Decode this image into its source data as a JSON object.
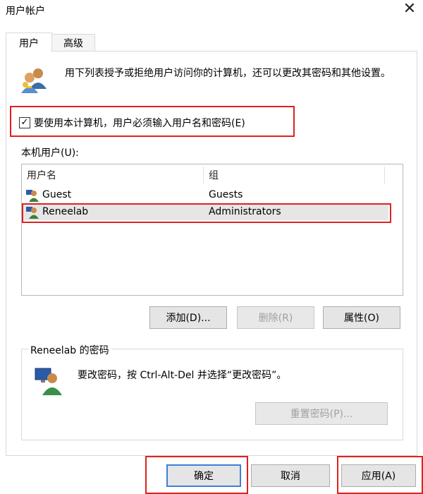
{
  "window": {
    "title": "用户帐户",
    "close_glyph": "✕"
  },
  "tabs": [
    {
      "label": "用户",
      "active": true
    },
    {
      "label": "高级",
      "active": false
    }
  ],
  "intro": {
    "icon": "users-icon",
    "text": "用下列表授予或拒绝用户访问你的计算机，还可以更改其密码和其他设置。"
  },
  "checkbox": {
    "checked": true,
    "mark": "✓",
    "label": "要使用本计算机，用户必须输入用户名和密码(E)"
  },
  "users": {
    "label": "本机用户(U):",
    "columns": [
      "用户名",
      "组"
    ],
    "rows": [
      {
        "name": "Guest",
        "group": "Guests",
        "selected": false
      },
      {
        "name": "Reneelab",
        "group": "Administrators",
        "selected": true
      }
    ]
  },
  "list_buttons": {
    "add": "添加(D)...",
    "remove": "删除(R)",
    "properties": "属性(O)"
  },
  "password_group": {
    "title": "Reneelab 的密码",
    "text": "要改密码，按 Ctrl-Alt-Del 并选择“更改密码”。",
    "reset_button": "重置密码(P)..."
  },
  "footer": {
    "ok": "确定",
    "cancel": "取消",
    "apply": "应用(A)"
  },
  "colors": {
    "highlight_red": "#e02020",
    "selection": "#e6e6e6",
    "focus_blue": "#3c7fd8"
  }
}
